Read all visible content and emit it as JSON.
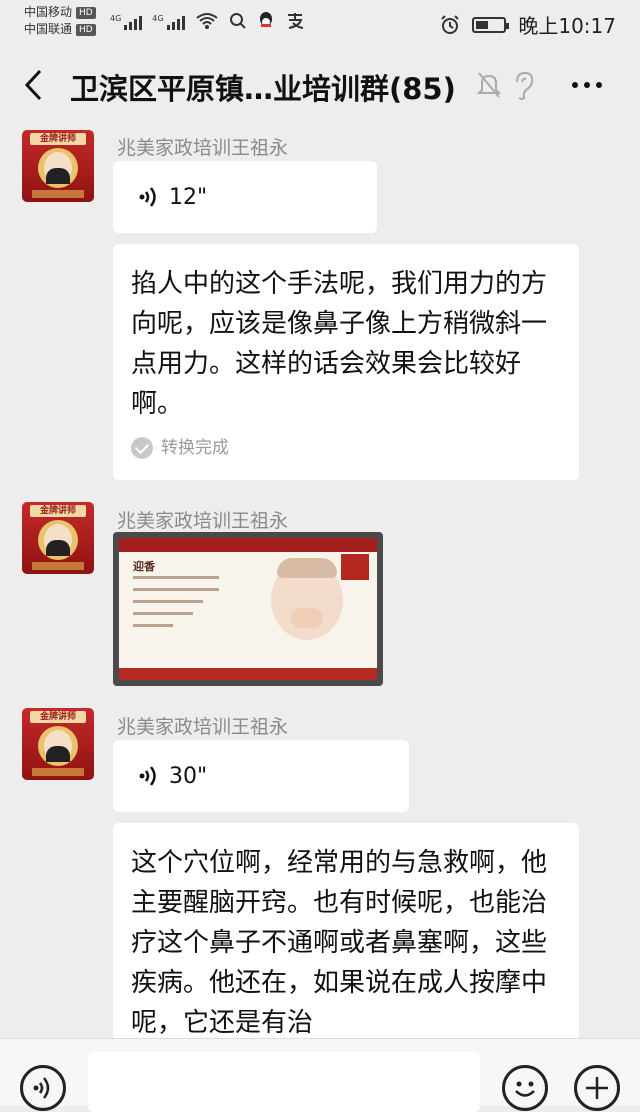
{
  "status_bar": {
    "carrier1": "中国移动",
    "carrier2": "中国联通",
    "hd": "HD",
    "network": "4G",
    "time": "晚上10:17",
    "battery_level": 0.45,
    "icons": [
      "signal-icon",
      "wifi-icon",
      "search-icon",
      "qq-icon",
      "alipay-icon",
      "alarm-icon",
      "battery-icon"
    ]
  },
  "nav": {
    "title": "卫滨区平原镇…业培训群(85)",
    "icons": [
      "back-icon",
      "mute-bell-icon",
      "earpiece-icon",
      "more-icon"
    ]
  },
  "messages": [
    {
      "sender": "兆美家政培训王祖永",
      "type": "voice",
      "duration": "12\"",
      "transcript": "掐人中的这个手法呢，我们用力的方向呢，应该是像鼻子像上方稍微斜一点用力。这样的话会效果会比较好啊。",
      "transcript_status": "转换完成"
    },
    {
      "sender": "兆美家政培训王祖永",
      "type": "image",
      "image_title": "迎香"
    },
    {
      "sender": "兆美家政培训王祖永",
      "type": "voice",
      "duration": "30\"",
      "transcript": "这个穴位啊，经常用的与急救啊，他主要醒脑开窍。也有时候呢，也能治疗这个鼻子不通啊或者鼻塞啊，这些疾病。他还在，如果说在成人按摩中呢，它还是有治"
    }
  ],
  "avatar": {
    "badge_text": "金牌讲师"
  },
  "input_bar": {
    "icons": [
      "voice-input-icon",
      "emoji-icon",
      "add-icon"
    ]
  }
}
